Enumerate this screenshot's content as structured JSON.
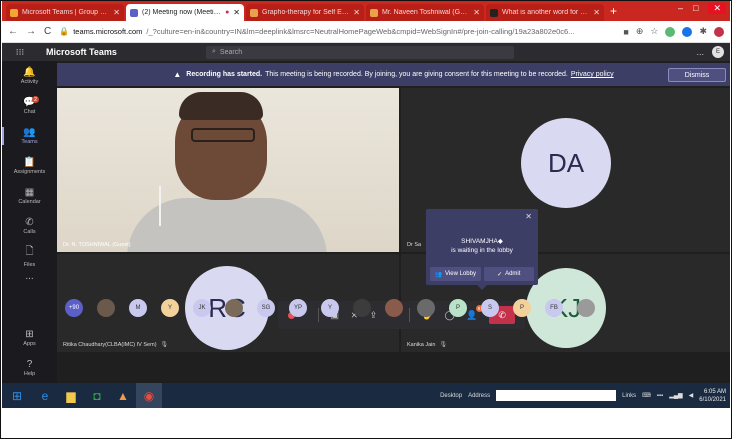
{
  "browser": {
    "tabs": [
      {
        "title": "Microsoft Teams | Group Chat",
        "favicon_color": "#f0a830",
        "active": false
      },
      {
        "title": "(2) Meeting now (Meeting)",
        "favicon_color": "#5b5fc7",
        "active": true
      },
      {
        "title": "Grapho-therapy for Self Evaluat",
        "favicon_color": "#e8a24a",
        "active": false
      },
      {
        "title": "Mr. Naveen Toshniwal (Grapho",
        "favicon_color": "#e8a24a",
        "active": false
      },
      {
        "title": "What is another word for accl",
        "favicon_color": "#222222",
        "active": false
      }
    ],
    "new_tab": "+",
    "url_host": "teams.microsoft.com",
    "url_path": "/_?culture=en-in&country=IN&lm=deeplink&lmsrc=NeutralHomePageWeb&cmpid=WebSignIn#/pre-join-calling/19a23a802e0c6...",
    "nav": {
      "back": "←",
      "forward": "→",
      "reload": "C"
    }
  },
  "teams": {
    "brand": "Microsoft Teams",
    "search_placeholder": "Search",
    "more": "...",
    "me_initial": "E"
  },
  "rail": {
    "items": [
      {
        "label": "Activity",
        "icon": "🔔"
      },
      {
        "label": "Chat",
        "icon": "💬",
        "badge": "2"
      },
      {
        "label": "Teams",
        "icon": "👥",
        "active": true
      },
      {
        "label": "Assignments",
        "icon": "📋"
      },
      {
        "label": "Calendar",
        "icon": "▦"
      },
      {
        "label": "Calls",
        "icon": "✆"
      },
      {
        "label": "Files",
        "icon": "🗋"
      }
    ],
    "more": "...",
    "bottom": [
      {
        "label": "Apps",
        "icon": "⊞"
      },
      {
        "label": "Help",
        "icon": "?"
      }
    ]
  },
  "banner": {
    "bold": "Recording has started.",
    "text": "This meeting is being recorded. By joining, you are giving consent for this meeting to be recorded.",
    "link": "Privacy policy",
    "dismiss": "Dismiss"
  },
  "tiles": {
    "video_name": "Dr. N. TOSHNIWAL (Guest)",
    "da_initials": "DA",
    "da_name": "Dr Sa",
    "rc_initials": "RC",
    "rc_name": "Ritika Chaudhary(CLBA(IMC) IV Sem)",
    "kj_initials": "KJ",
    "kj_name": "Kanika Jain"
  },
  "lobby": {
    "name": "SHIVAMJHA◆",
    "message": "is waiting in the lobby",
    "view_lobby": "View Lobby",
    "admit": "Admit",
    "close": "✕"
  },
  "controls": {
    "timer": "",
    "participants_badge": "9"
  },
  "strip": [
    {
      "text": "+90",
      "color": "#5b5fc7"
    },
    {
      "text": "",
      "color": "#6b5a4c"
    },
    {
      "text": "M",
      "color": "#c9c9f0"
    },
    {
      "text": "Y",
      "color": "#f3d19b"
    },
    {
      "text": "JK",
      "color": "#c9c9f0"
    },
    {
      "text": "",
      "color": "#7a6a5a"
    },
    {
      "text": "SG",
      "color": "#c9c9f0"
    },
    {
      "text": "YP",
      "color": "#c9c9f0"
    },
    {
      "text": "Y",
      "color": "#c9c9f0"
    },
    {
      "text": "",
      "color": "#3c3c3c"
    },
    {
      "text": "",
      "color": "#8a5a4a"
    },
    {
      "text": "",
      "color": "#6a6a6a"
    },
    {
      "text": "P",
      "color": "#b9e3c9"
    },
    {
      "text": "S",
      "color": "#c9c9f0"
    },
    {
      "text": "P",
      "color": "#f3d19b"
    },
    {
      "text": "FB",
      "color": "#c9c9f0"
    },
    {
      "text": "",
      "color": "#9a9a9a"
    }
  ],
  "taskbar": {
    "desktop": "Desktop",
    "address": "Address",
    "links": "Links",
    "time": "6:05 AM",
    "date": "6/10/2021"
  }
}
